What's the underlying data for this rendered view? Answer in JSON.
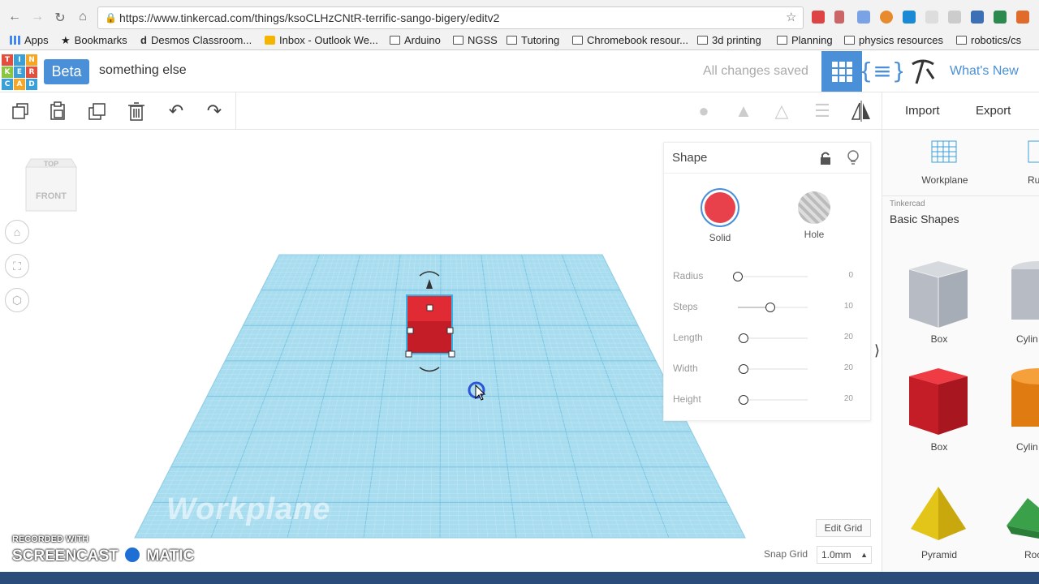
{
  "browser": {
    "url": "https://www.tinkercad.com/things/ksoCLHzCNtR-terrific-sango-bigery/editv2",
    "bookmarks": [
      "Apps",
      "Bookmarks",
      "Desmos Classroom...",
      "Inbox - Outlook We...",
      "Arduino",
      "NGSS",
      "Tutoring",
      "Chromebook resour...",
      "3d printing",
      "Planning",
      "physics resources",
      "robotics/cs"
    ]
  },
  "header": {
    "logo_letters": [
      "T",
      "I",
      "N",
      "K",
      "E",
      "R",
      "C",
      "A",
      "D"
    ],
    "beta_label": "Beta",
    "doc_name": "something else",
    "save_status": "All changes saved",
    "whats_new": "What's New"
  },
  "toolbar": {
    "import_label": "Import",
    "export_label": "Export"
  },
  "viewcube": {
    "top": "TOP",
    "front": "FRONT"
  },
  "workplane": {
    "label": "Workplane",
    "edit_grid": "Edit Grid",
    "snap_grid_label": "Snap Grid",
    "snap_grid_value": "1.0mm"
  },
  "inspector": {
    "title": "Shape",
    "solid_label": "Solid",
    "hole_label": "Hole",
    "solid_color": "#e8414b",
    "props": [
      {
        "name": "Radius",
        "value": "0",
        "level": 0.0
      },
      {
        "name": "Steps",
        "value": "10",
        "level": 0.47
      },
      {
        "name": "Length",
        "value": "20",
        "level": 0.08
      },
      {
        "name": "Width",
        "value": "20",
        "level": 0.08
      },
      {
        "name": "Height",
        "value": "20",
        "level": 0.08
      }
    ]
  },
  "library": {
    "workplane_label": "Workplane",
    "ruler_label": "Ru",
    "source": "Tinkercad",
    "category": "Basic Shapes",
    "items": [
      "Box",
      "Cylin",
      "Box",
      "Cylin",
      "Pyramid",
      "Roo"
    ]
  },
  "watermark": {
    "line1": "RECORDED WITH",
    "line2": "SCREENCAST",
    "line3": "MATIC"
  },
  "colors": {
    "accent": "#4a90d9",
    "grid": "#a8dcef",
    "box_red": "#d9232d"
  }
}
